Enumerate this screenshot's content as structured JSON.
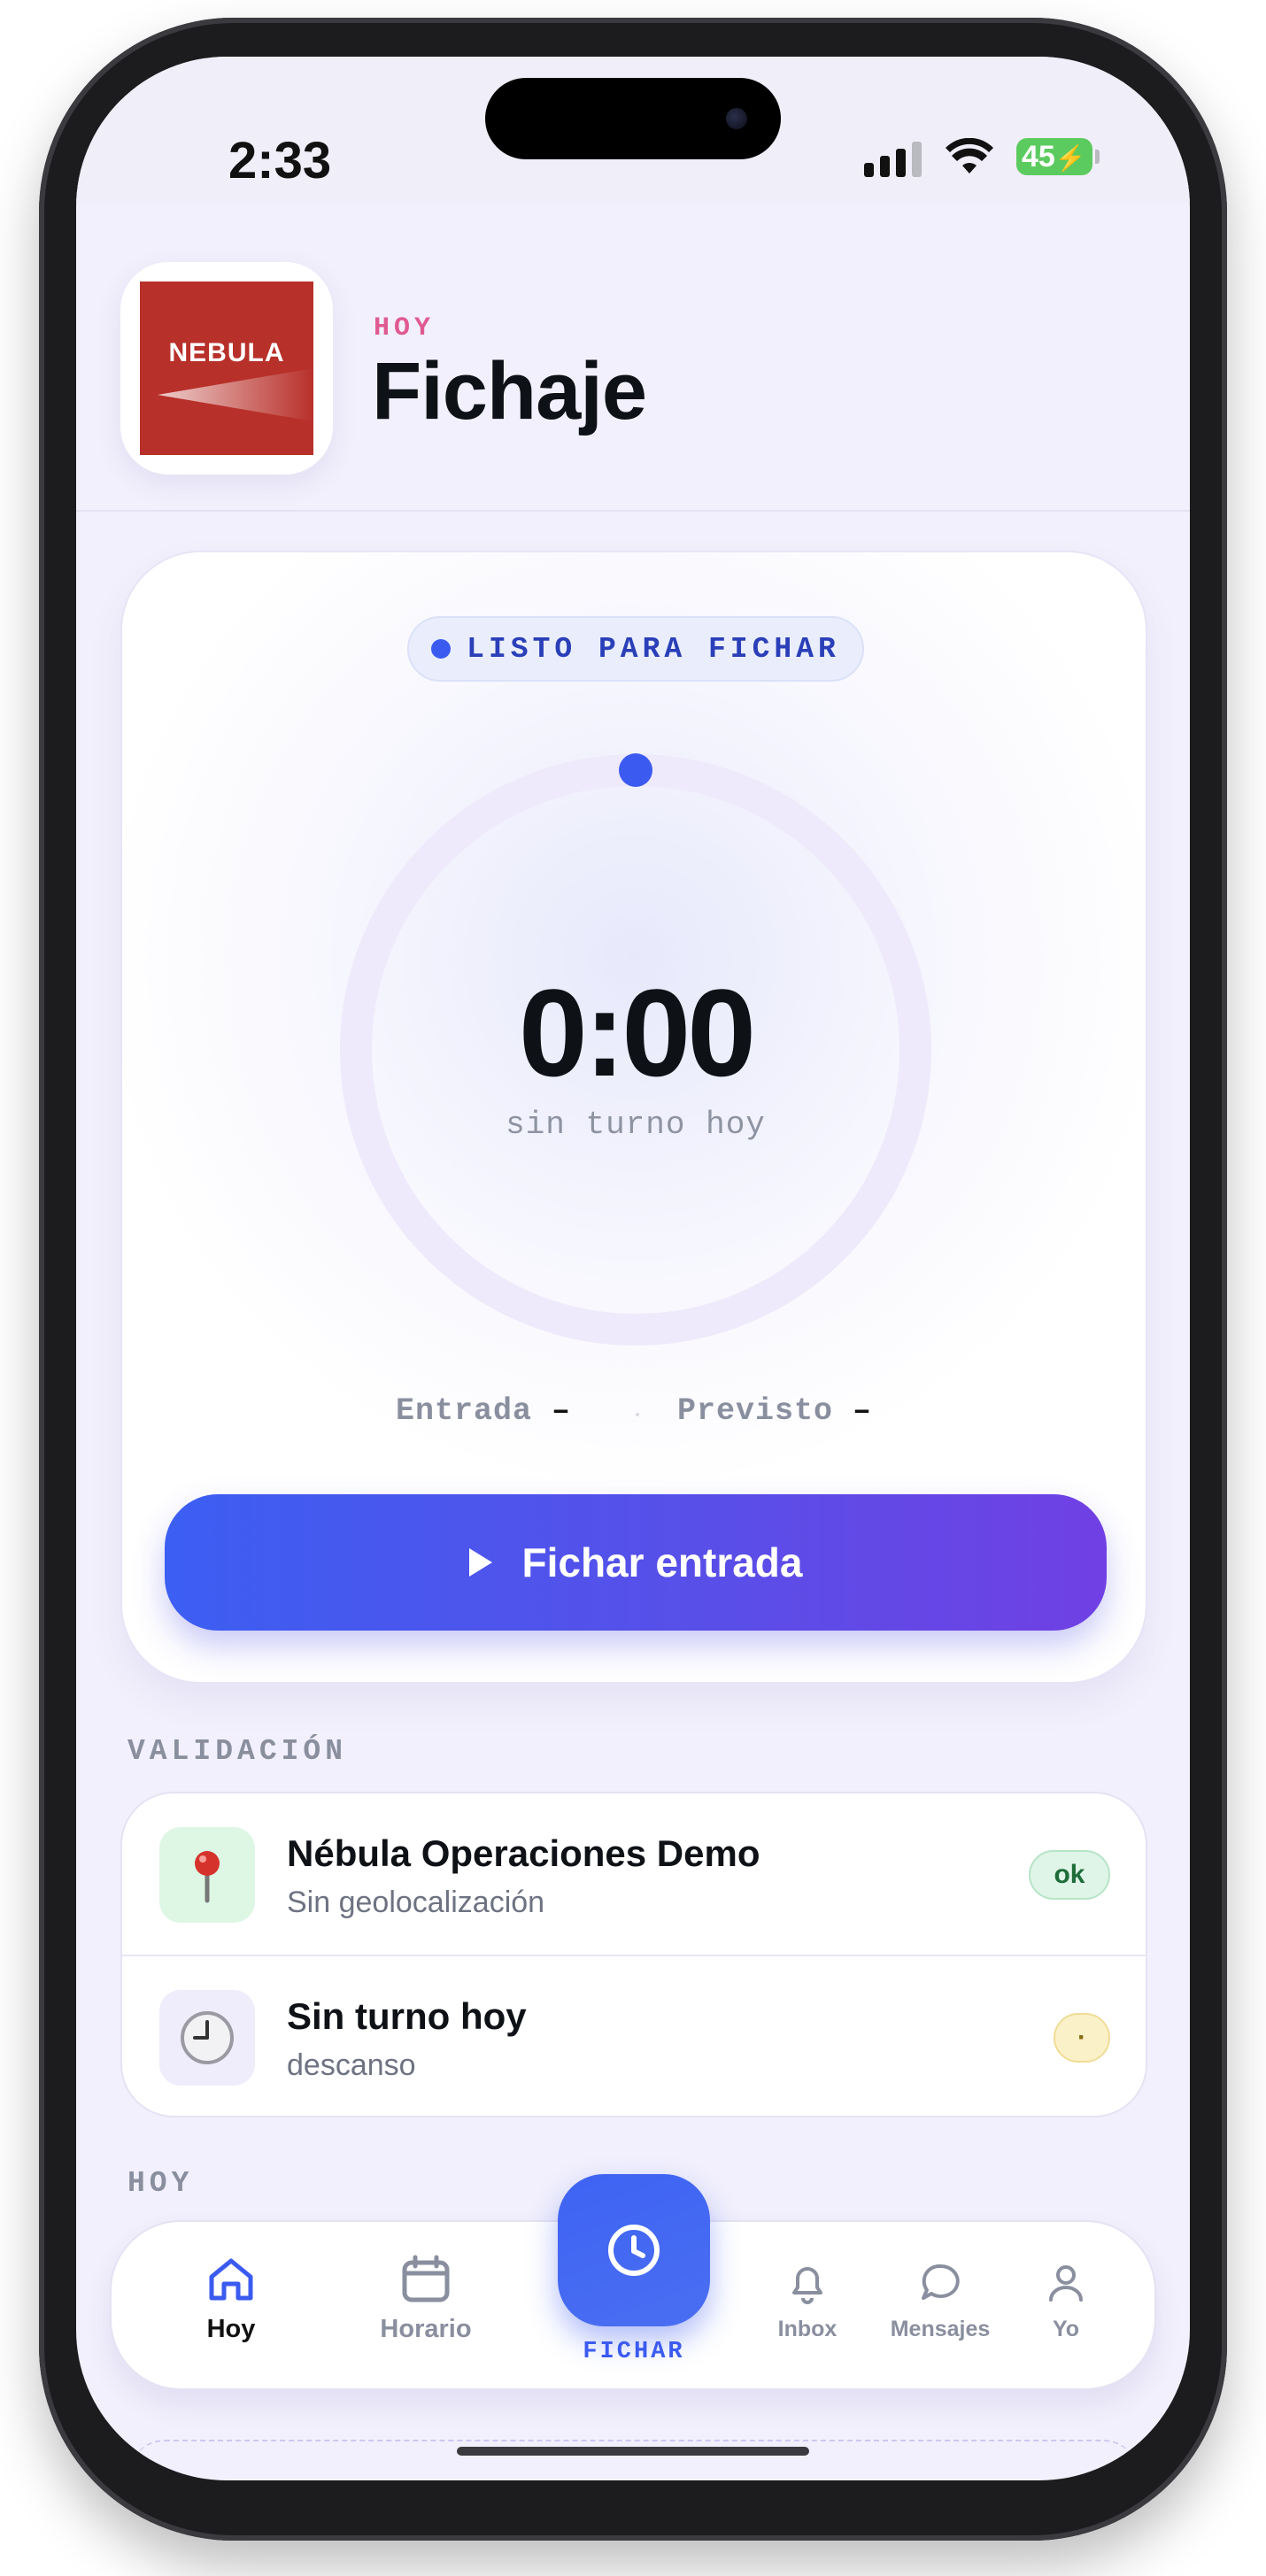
{
  "status_bar": {
    "time": "2:33",
    "battery": "45"
  },
  "header": {
    "logo_text": "NEBULA",
    "eyebrow": "HOY",
    "title": "Fichaje"
  },
  "clock_card": {
    "status_pill": "LISTO PARA FICHAR",
    "elapsed": "0:00",
    "subtitle": "sin turno hoy",
    "entrada_label": "Entrada",
    "entrada_value": "–",
    "previsto_label": "Previsto",
    "previsto_value": "–",
    "cta_label": "Fichar entrada",
    "progress": 0
  },
  "validation": {
    "section_label": "VALIDACIÓN",
    "rows": [
      {
        "icon": "pin-icon",
        "title": "Nébula Operaciones Demo",
        "subtitle": "Sin geolocalización",
        "badge": "ok"
      },
      {
        "icon": "clock-icon",
        "title": "Sin turno hoy",
        "subtitle": "descanso",
        "badge": "·"
      }
    ]
  },
  "today_section": {
    "label": "HOY"
  },
  "tabbar": {
    "items": [
      {
        "label": "Hoy",
        "icon": "home-icon",
        "active": true
      },
      {
        "label": "Horario",
        "icon": "calendar-icon"
      },
      {
        "label": "FICHAR",
        "icon": "clock-icon"
      },
      {
        "label": "Inbox",
        "icon": "bell-icon"
      },
      {
        "label": "Mensajes",
        "icon": "chat-icon"
      },
      {
        "label": "Yo",
        "icon": "person-icon"
      }
    ]
  },
  "colors": {
    "accent": "#3b5bf0",
    "accent_end": "#7040e4",
    "ok_badge": "#def5e6",
    "warn_badge": "#fbf1c9",
    "logo_bg": "#b8302a"
  }
}
